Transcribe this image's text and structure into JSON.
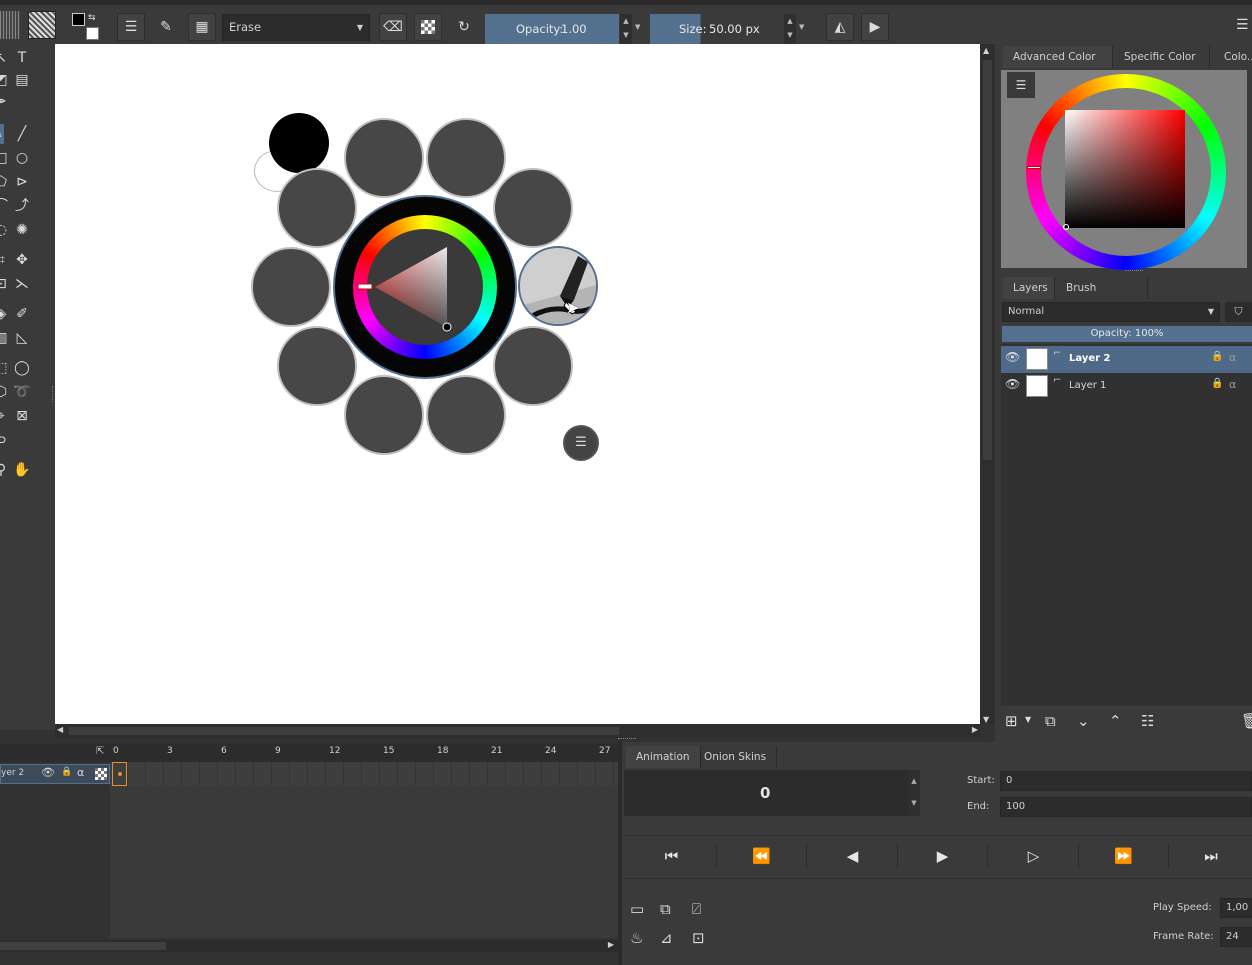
{
  "toolbar": {
    "brush_preset_label": "Erase",
    "opacity_label": "Opacity:",
    "opacity_value": "1.00",
    "size_label": "Size:",
    "size_value": "50.00 px"
  },
  "docker_tabs": [
    "Advanced Color ...",
    "Specific Color ...",
    "Colo..."
  ],
  "layers_tabs": [
    "Layers",
    "Brush Presets"
  ],
  "blend_mode": "Normal",
  "layer_opacity": "Opacity:  100%",
  "layers": [
    {
      "name": "Layer 2",
      "selected": true
    },
    {
      "name": "Layer 1",
      "selected": false
    }
  ],
  "timeline": {
    "ruler_ticks": [
      "0",
      "3",
      "6",
      "9",
      "12",
      "15",
      "18",
      "21",
      "24",
      "27"
    ],
    "layer_name": "yer 2"
  },
  "animation": {
    "tabs": [
      "Animation",
      "Onion Skins"
    ],
    "current_frame": "0",
    "start_label": "Start:",
    "start_value": "0",
    "end_label": "End:",
    "end_value": "100",
    "play_speed_label": "Play Speed:",
    "play_speed_value": "1,00",
    "frame_rate_label": "Frame Rate:",
    "frame_rate_value": "24"
  },
  "colors": {
    "accent": "#54708f",
    "selection": "#4f6a88",
    "keyframe": "#e8902a"
  }
}
